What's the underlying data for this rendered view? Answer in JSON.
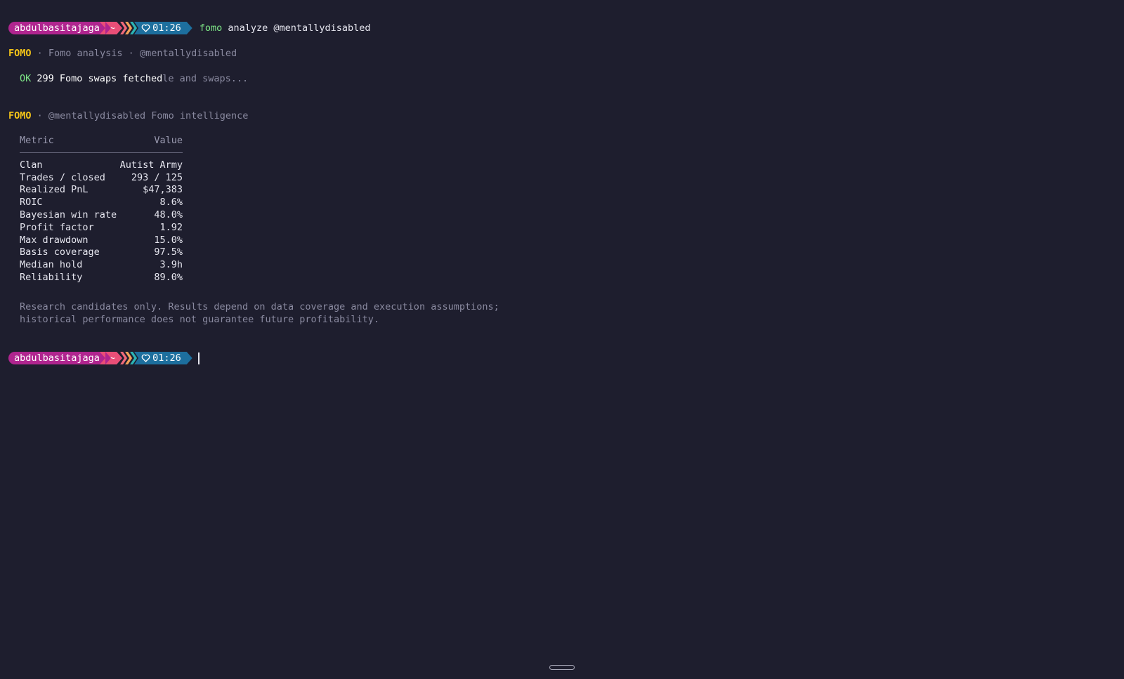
{
  "prompt_top": {
    "user": "abdulbasitajaga",
    "dir": "~",
    "time": "01:26",
    "command_bin": "fomo",
    "command_args": "analyze @mentallydisabled"
  },
  "header1": {
    "brand": "FOMO",
    "text": " · Fomo analysis · @mentallydisabled"
  },
  "status": {
    "ok": "OK",
    "message": "299 Fomo swaps fetched",
    "ghost": "le and swaps..."
  },
  "header2": {
    "brand": "FOMO",
    "text": " · @mentallydisabled Fomo intelligence"
  },
  "table": {
    "headers": [
      "Metric",
      "Value"
    ],
    "rows": [
      {
        "metric": "Clan",
        "value": "Autist Army"
      },
      {
        "metric": "Trades / closed",
        "value": "293 / 125"
      },
      {
        "metric": "Realized PnL",
        "value": "$47,383"
      },
      {
        "metric": "ROIC",
        "value": "8.6%"
      },
      {
        "metric": "Bayesian win rate",
        "value": "48.0%"
      },
      {
        "metric": "Profit factor",
        "value": "1.92"
      },
      {
        "metric": "Max drawdown",
        "value": "15.0%"
      },
      {
        "metric": "Basis coverage",
        "value": "97.5%"
      },
      {
        "metric": "Median hold",
        "value": "3.9h"
      },
      {
        "metric": "Reliability",
        "value": "89.0%"
      }
    ]
  },
  "disclaimer": {
    "line1": "Research candidates only. Results depend on data coverage and execution assumptions;",
    "line2": "historical performance does not guarantee future profitability."
  },
  "prompt_bottom": {
    "user": "abdulbasitajaga",
    "dir": "~",
    "time": "01:26"
  },
  "icons": {
    "prompt_time": "heart-icon"
  },
  "colors": {
    "background": "#1e1e2e",
    "brand": "#f5c518",
    "ok": "#7ee787",
    "segment_user": "#b0258f",
    "segment_dir": "#e94e77",
    "segment_time": "#1d6f9e"
  }
}
